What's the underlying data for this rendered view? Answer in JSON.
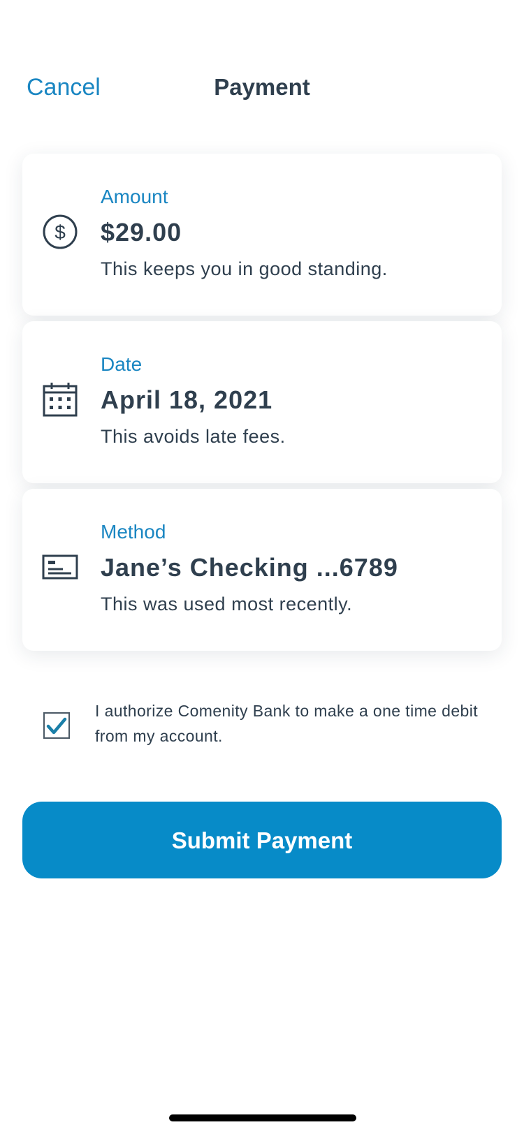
{
  "header": {
    "cancel_label": "Cancel",
    "title": "Payment"
  },
  "cards": [
    {
      "label": "Amount",
      "value": "$29.00",
      "note": "This keeps you in good standing.",
      "icon": "dollar-circle-icon"
    },
    {
      "label": "Date",
      "value": "April 18, 2021",
      "note": "This avoids late fees.",
      "icon": "calendar-icon"
    },
    {
      "label": "Method",
      "value": "Jane’s Checking ...6789",
      "note": "This was used most recently.",
      "icon": "bank-check-icon"
    }
  ],
  "authorization": {
    "checked": true,
    "text": "I authorize Comenity Bank to make a one time debit from my account."
  },
  "submit": {
    "label": "Submit Payment"
  },
  "colors": {
    "accent": "#1a86c2",
    "button": "#078bc8",
    "text": "#2f3f4e",
    "checkmark": "#1a7fa8"
  }
}
